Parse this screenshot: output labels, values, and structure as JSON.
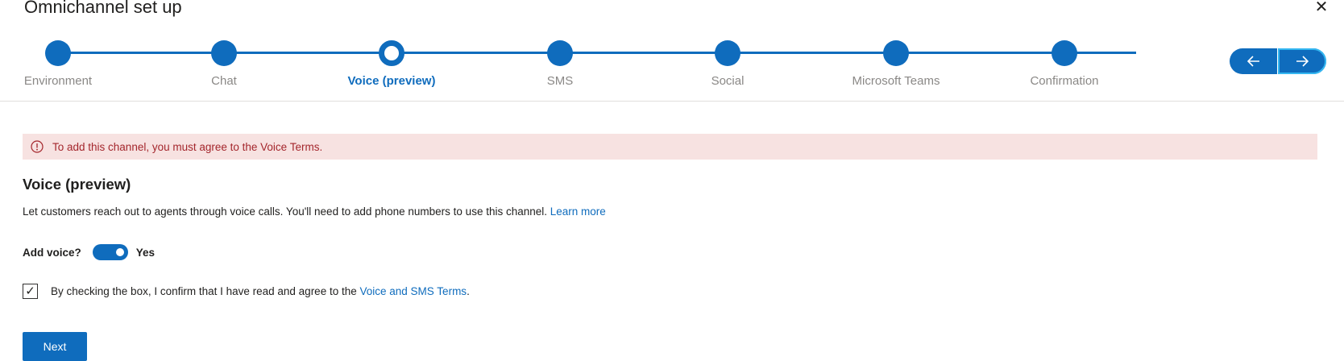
{
  "window": {
    "title": "Omnichannel set up",
    "close_glyph": "✕"
  },
  "stepper": {
    "steps": [
      {
        "label": "Environment",
        "state": "complete"
      },
      {
        "label": "Chat",
        "state": "complete"
      },
      {
        "label": "Voice (preview)",
        "state": "current"
      },
      {
        "label": "SMS",
        "state": "complete"
      },
      {
        "label": "Social",
        "state": "complete"
      },
      {
        "label": "Microsoft Teams",
        "state": "complete"
      },
      {
        "label": "Confirmation",
        "state": "complete"
      }
    ],
    "prev_icon": "arrow-left-icon",
    "next_icon": "arrow-right-icon"
  },
  "alert": {
    "icon": "error-circle-icon",
    "message": "To add this channel, you must agree to the Voice Terms."
  },
  "section": {
    "title": "Voice (preview)",
    "description": "Let customers reach out to agents through voice calls. You'll need to add phone numbers to use this channel. ",
    "learn_more": "Learn more"
  },
  "toggle": {
    "label": "Add voice?",
    "value": "Yes",
    "on": true
  },
  "terms": {
    "checked": true,
    "check_glyph": "✓",
    "text": "By checking the box, I confirm that I have read and agree to the ",
    "link": "Voice and SMS Terms",
    "suffix": "."
  },
  "buttons": {
    "next_label": "Next"
  },
  "colors": {
    "accent": "#0f6cbd",
    "alert_bg": "#f7e2e1",
    "alert_text": "#a4262c"
  }
}
